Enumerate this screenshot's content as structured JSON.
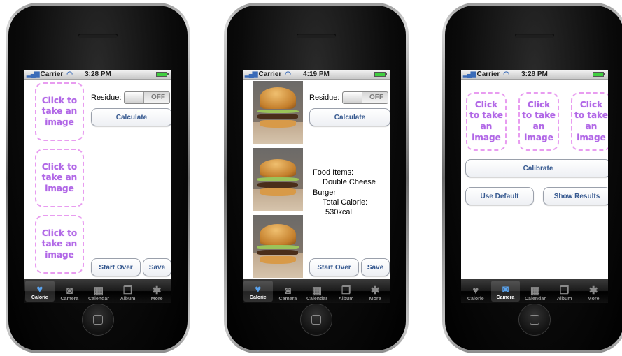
{
  "status": {
    "carrier": "Carrier",
    "bars": "▂▄▆",
    "wifi": "◠"
  },
  "tabs": [
    {
      "label": "Calorie",
      "icon": "heart-icon"
    },
    {
      "label": "Camera",
      "icon": "camera-icon"
    },
    {
      "label": "Calendar",
      "icon": "calendar-icon"
    },
    {
      "label": "Album",
      "icon": "album-icon"
    },
    {
      "label": "More",
      "icon": "gears-icon"
    }
  ],
  "phone1": {
    "time": "3:28 PM",
    "slots": [
      "Click to take an image",
      "Click to take an image",
      "Click to take an image"
    ],
    "residue_label": "Residue:",
    "toggle_state": "OFF",
    "calculate": "Calculate",
    "start_over": "Start Over",
    "save": "Save",
    "active_tab": "Calorie"
  },
  "phone2": {
    "time": "4:19 PM",
    "residue_label": "Residue:",
    "toggle_state": "OFF",
    "calculate": "Calculate",
    "food_items_label": "Food Items:",
    "food_name_1": "Double Cheese",
    "food_name_2": "Burger",
    "total_calorie_label": "Total Calorie:",
    "total_calorie_value": "530kcal",
    "start_over": "Start Over",
    "save": "Save",
    "active_tab": "Calorie"
  },
  "phone3": {
    "time": "3:28 PM",
    "slots": [
      "Click to take an image",
      "Click to take an image",
      "Click to take an image"
    ],
    "calibrate": "Calibrate",
    "use_default": "Use Default",
    "show_results": "Show Results",
    "active_tab": "Camera"
  }
}
